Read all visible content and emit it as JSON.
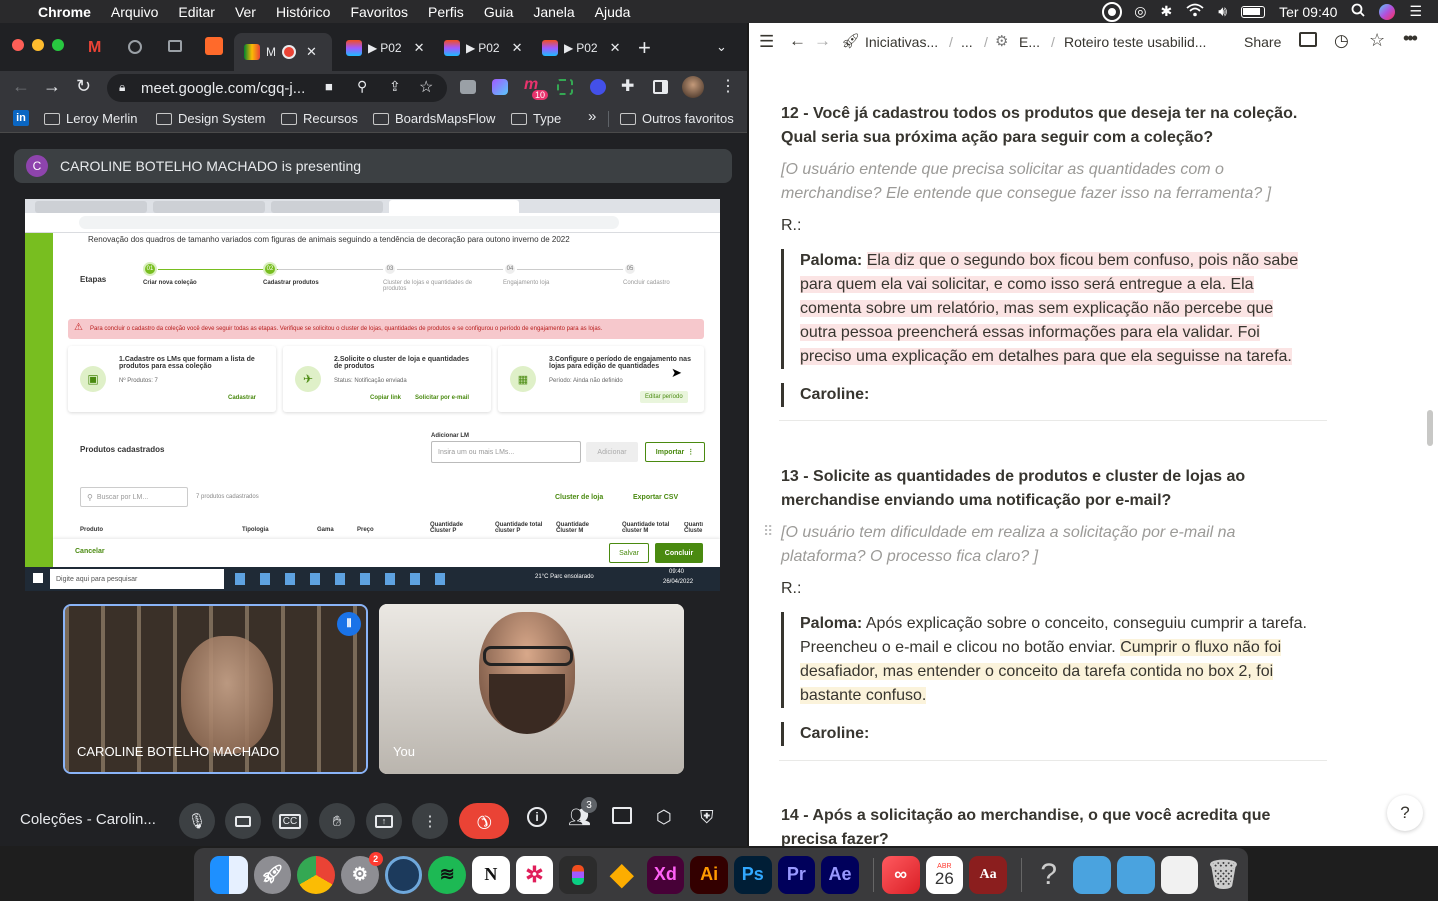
{
  "menubar": {
    "app": "Chrome",
    "items": [
      "Arquivo",
      "Editar",
      "Ver",
      "Histórico",
      "Favoritos",
      "Perfis",
      "Guia",
      "Janela",
      "Ajuda"
    ],
    "clock": "Ter 09:40"
  },
  "chrome": {
    "tabs": [
      {
        "label": "M",
        "active": true
      },
      {
        "label": "P02"
      },
      {
        "label": "P02"
      },
      {
        "label": "P02"
      }
    ],
    "url": "meet.google.com/cgq-j...",
    "extension_badge": "10",
    "bookmarks": [
      "Leroy Merlin",
      "Design System",
      "Recursos",
      "BoardsMapsFlow",
      "Type"
    ],
    "bookmarks_more": "»",
    "other_bookmarks": "Outros favoritos"
  },
  "meet": {
    "presenting_avatar": "C",
    "presenting_text": "CAROLINE BOTELHO MACHADO is presenting",
    "participant1": "CAROLINE BOTELHO MACHADO",
    "participant2": "You",
    "meeting_title": "Coleções - Carolin...",
    "people_count": "3"
  },
  "shared_screen": {
    "subtitle": "Renovação dos quadros de tamanho variados com figuras de animais seguindo a tendência de decoração para outono inverno de 2022",
    "steps_label": "Etapas",
    "steps": [
      {
        "num": "01",
        "label": "Criar nova coleção"
      },
      {
        "num": "02",
        "label": "Cadastrar produtos"
      },
      {
        "num": "03",
        "label": "Cluster de lojas e quantidades de produtos"
      },
      {
        "num": "04",
        "label": "Engajamento loja"
      },
      {
        "num": "05",
        "label": "Concluir cadastro"
      }
    ],
    "alert": "Para concluir o cadastro da coleção você deve seguir todas as etapas. Verifique se solicitou o cluster de lojas, quantidades de produtos e se configurou o período de engajamento para as lojas.",
    "card1_title": "1.Cadastre os LMs que formam a lista de produtos para essa coleção",
    "card1_meta": "Nº Produtos: 7",
    "card1_action": "Cadastrar",
    "card2_title": "2.Solicite o cluster de loja e quantidades de produtos",
    "card2_meta": "Status: Notificação enviada",
    "card2_action1": "Copiar link",
    "card2_action2": "Solicitar por e-mail",
    "card3_title": "3.Configure o período de engajamento nas lojas para edição de quantidades",
    "card3_meta": "Período: Ainda não definido",
    "card3_action": "Editar período",
    "products_title": "Produtos cadastrados",
    "add_lm_label": "Adicionar LM",
    "add_lm_placeholder": "Insira um ou mais LMs...",
    "add_button": "Adicionar",
    "import_button": "Importar",
    "search_placeholder": "Buscar por LM...",
    "count": "7 produtos cadastrados",
    "cluster_link": "Cluster de loja",
    "export_link": "Exportar CSV",
    "columns": [
      "Produto",
      "Tipologia",
      "Gama",
      "Preço",
      "Quantidade Cluster P",
      "Quantidade total cluster P",
      "Quantidade Cluster M",
      "Quantidade total cluster M",
      "Quanti Cluste"
    ],
    "cancel": "Cancelar",
    "save": "Salvar",
    "finish": "Concluir",
    "taskbar_search": "Digite aqui para pesquisar",
    "weather": "21°C  Parc ensolarado",
    "time": "09:40",
    "date": "26/04/2022"
  },
  "notion": {
    "breadcrumb": [
      "Iniciativas...",
      "...",
      "E...",
      "Roteiro teste usabilid..."
    ],
    "share": "Share",
    "q12_title": "12 - Você já cadastrou todos os produtos que deseja ter na coleção. Qual seria sua próxima ação para seguir com a coleção?",
    "q12_sub": "[O usuário entende que precisa solicitar as quantidades com o merchandise? Ele entende que consegue fazer isso na ferramenta? ]",
    "r_label": "R.:",
    "q12_paloma_label": "Paloma:",
    "q12_paloma_text": "Ela diz que o segundo box ficou bem confuso, pois não sabe para quem ela vai solicitar, e como isso será entregue a ela. Ela comenta sobre um relatório, mas sem explicação não percebe que outra pessoa preencherá essas informações para ela validar. Foi preciso uma explicação em detalhes para que ela seguisse na tarefa.",
    "caroline_label": "Caroline:",
    "q13_title": "13 - Solicite as quantidades de produtos e cluster de lojas ao merchandise enviando uma notificação por e-mail?",
    "q13_sub": "[O usuário tem dificuldade em realiza a solicitação por e-mail na plataforma? O processo fica claro? ]",
    "q13_paloma_label": "Paloma:",
    "q13_paloma_plain": "Após explicação sobre o conceito, conseguiu cumprir a tarefa. Preencheu o e-mail e clicou no botão enviar.",
    "q13_paloma_hl": "Cumprir o fluxo não foi desafiador, mas entender o conceito da tarefa contida no box 2, foi bastante confuso.",
    "q14_title": "14 - Após a solicitação ao merchandise, o que você acredita que precisa fazer?",
    "help": "?"
  },
  "dock": {
    "badge_settings": "2",
    "calendar_month": "ABR",
    "calendar_day": "26"
  }
}
